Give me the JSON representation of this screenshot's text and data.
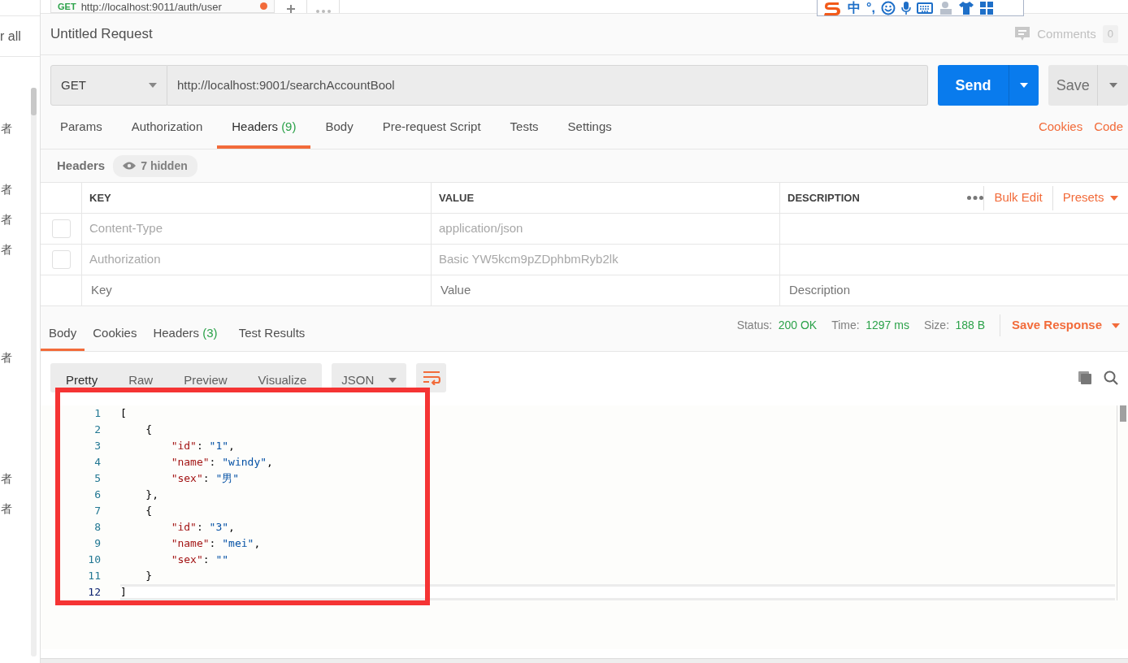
{
  "sidebar": {
    "label": "r all",
    "entries": [
      "者",
      "者",
      "者",
      "者",
      "者",
      "者",
      "者"
    ]
  },
  "request_tab": {
    "method": "GET",
    "url": "http://localhost:9011/auth/user",
    "unsaved": true
  },
  "ime_toolbar": {
    "mode": "中",
    "punctuation": "°,"
  },
  "title": "Untitled Request",
  "comments": {
    "label": "Comments",
    "count": "0"
  },
  "request": {
    "method": "GET",
    "url": "http://localhost:9001/searchAccountBool",
    "send": "Send",
    "save": "Save"
  },
  "request_tabs": [
    {
      "label": "Params",
      "selected": false
    },
    {
      "label": "Authorization",
      "selected": false
    },
    {
      "label": "Headers",
      "count": "(9)",
      "selected": true
    },
    {
      "label": "Body",
      "selected": false
    },
    {
      "label": "Pre-request Script",
      "selected": false
    },
    {
      "label": "Tests",
      "selected": false
    },
    {
      "label": "Settings",
      "selected": false
    }
  ],
  "request_links": [
    "Cookies",
    "Code"
  ],
  "headers": {
    "title": "Headers",
    "hidden": "7 hidden",
    "columns": [
      "KEY",
      "VALUE",
      "DESCRIPTION"
    ],
    "actions": [
      "Bulk Edit",
      "Presets"
    ],
    "rows": [
      {
        "key": "Content-Type",
        "value": "application/json",
        "checked": false
      },
      {
        "key": "Authorization",
        "value": "Basic YW5kcm9pZDphbmRyb2lk",
        "checked": false
      }
    ],
    "new_row": {
      "key_placeholder": "Key",
      "value_placeholder": "Value",
      "description_placeholder": "Description"
    }
  },
  "response": {
    "tabs": [
      {
        "label": "Body",
        "selected": true
      },
      {
        "label": "Cookies",
        "selected": false
      },
      {
        "label": "Headers",
        "count": "(3)",
        "selected": false
      },
      {
        "label": "Test Results",
        "selected": false
      }
    ],
    "stats": [
      {
        "label": "Status:",
        "value": "200 OK"
      },
      {
        "label": "Time:",
        "value": "1297 ms"
      },
      {
        "label": "Size:",
        "value": "188 B"
      }
    ],
    "save": "Save Response",
    "views": [
      {
        "label": "Pretty",
        "selected": true
      },
      {
        "label": "Raw",
        "selected": false
      },
      {
        "label": "Preview",
        "selected": false
      },
      {
        "label": "Visualize",
        "selected": false
      }
    ],
    "format": "JSON",
    "code_lines": [
      {
        "number": "1",
        "text": "[",
        "current": false
      },
      {
        "number": "2",
        "text": "    {",
        "current": false
      },
      {
        "number": "3",
        "text": "        \"id\": \"1\",",
        "current": false
      },
      {
        "number": "4",
        "text": "        \"name\": \"windy\",",
        "current": false
      },
      {
        "number": "5",
        "text": "        \"sex\": \"男\"",
        "current": false
      },
      {
        "number": "6",
        "text": "    },",
        "current": false
      },
      {
        "number": "7",
        "text": "    {",
        "current": false
      },
      {
        "number": "8",
        "text": "        \"id\": \"3\",",
        "current": false
      },
      {
        "number": "9",
        "text": "        \"name\": \"mei\",",
        "current": false
      },
      {
        "number": "10",
        "text": "        \"sex\": \"\"",
        "current": false
      },
      {
        "number": "11",
        "text": "    }",
        "current": false
      },
      {
        "number": "12",
        "text": "]",
        "current": true
      }
    ]
  }
}
